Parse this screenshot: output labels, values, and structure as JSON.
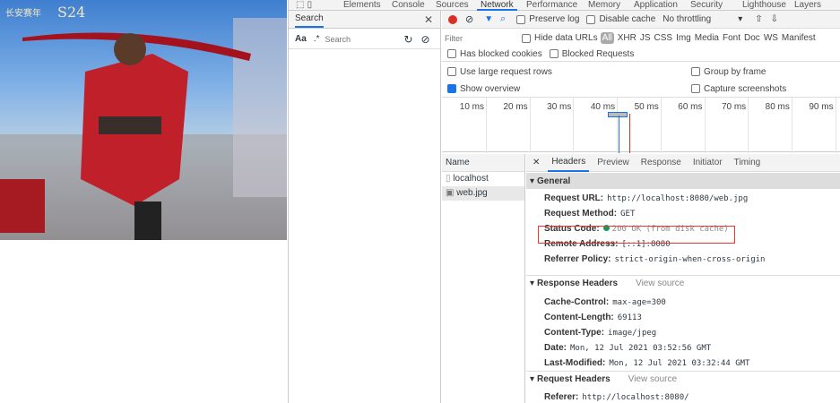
{
  "image": {
    "logo_text": "长安赛年",
    "season": "S24"
  },
  "tabs": [
    "Elements",
    "Console",
    "Sources",
    "Network",
    "Performance",
    "Memory",
    "Application",
    "Security",
    "Lighthouse",
    "Layers"
  ],
  "search": {
    "title": "Search",
    "case_label": "Aa",
    "regex_label": ".*",
    "placeholder": "Search"
  },
  "toolbar": {
    "preserve_log": "Preserve log",
    "disable_cache": "Disable cache",
    "throttling": "No throttling"
  },
  "filter": {
    "placeholder": "Filter",
    "hide_data_urls": "Hide data URLs",
    "types": [
      "All",
      "XHR",
      "JS",
      "CSS",
      "Img",
      "Media",
      "Font",
      "Doc",
      "WS",
      "Manifest"
    ],
    "has_blocked_cookies": "Has blocked cookies",
    "blocked_requests": "Blocked Requests"
  },
  "options": {
    "large_rows": "Use large request rows",
    "group_by_frame": "Group by frame",
    "show_overview": "Show overview",
    "capture_screenshots": "Capture screenshots"
  },
  "overview": {
    "ticks": [
      "10 ms",
      "20 ms",
      "30 ms",
      "40 ms",
      "50 ms",
      "60 ms",
      "70 ms",
      "80 ms",
      "90 ms"
    ]
  },
  "requests": {
    "header": "Name",
    "items": [
      "localhost",
      "web.jpg"
    ]
  },
  "detail_tabs": [
    "Headers",
    "Preview",
    "Response",
    "Initiator",
    "Timing"
  ],
  "general": {
    "title": "General",
    "rows": [
      {
        "k": "Request URL:",
        "v": "http://localhost:8080/web.jpg"
      },
      {
        "k": "Request Method:",
        "v": "GET"
      },
      {
        "k": "Status Code:",
        "v": "200 OK (from disk cache)"
      },
      {
        "k": "Remote Address:",
        "v": "[::1]:8080"
      },
      {
        "k": "Referrer Policy:",
        "v": "strict-origin-when-cross-origin"
      }
    ]
  },
  "response_headers": {
    "title": "Response Headers",
    "view_source": "View source",
    "rows": [
      {
        "k": "Cache-Control:",
        "v": "max-age=300"
      },
      {
        "k": "Content-Length:",
        "v": "69113"
      },
      {
        "k": "Content-Type:",
        "v": "image/jpeg"
      },
      {
        "k": "Date:",
        "v": "Mon, 12 Jul 2021 03:52:56 GMT"
      },
      {
        "k": "Last-Modified:",
        "v": "Mon, 12 Jul 2021 03:32:44 GMT"
      }
    ]
  },
  "request_headers": {
    "title": "Request Headers",
    "view_source": "View source",
    "rows": [
      {
        "k": "Referer:",
        "v": "http://localhost:8080/"
      }
    ]
  },
  "colors": {
    "accent": "#1a73e8",
    "record": "#d93025",
    "status_ok": "#0f9d58",
    "highlight_box": "#e53935"
  }
}
